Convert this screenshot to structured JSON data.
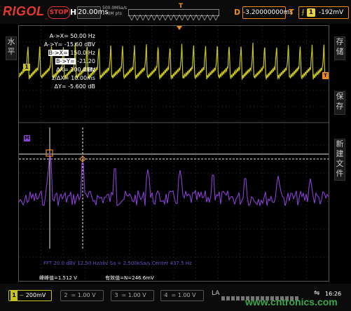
{
  "header": {
    "brand": "RIGOL",
    "run_state": "STOP",
    "timebase_label": "H",
    "timebase": "20.00ms",
    "sample_rate": "500.0MSa/s",
    "memory_depth": "140M pts",
    "delay_label": "D",
    "delay": "-3.20000000ms",
    "trigger_label": "T",
    "trigger_channel": "1",
    "trigger_level": "-192mV"
  },
  "left_menu": {
    "label": "水平"
  },
  "right_menu": {
    "items": [
      "存储",
      "保存",
      "新建文件"
    ]
  },
  "measurements": [
    {
      "label": "A->X=",
      "value": "50.00 Hz",
      "highlight": false
    },
    {
      "label": "A->Y=",
      "value": "-15.60 dBV",
      "highlight": false
    },
    {
      "label": "B->X=",
      "value": "150.0 Hz",
      "highlight": true
    },
    {
      "label": "B->Y=",
      "value": "-21.20 dBV",
      "highlight": true
    },
    {
      "label": "ΔX=",
      "value": "100.0 Hz",
      "highlight": false
    },
    {
      "label": "1/ΔX=",
      "value": "10.00ms",
      "highlight": false
    },
    {
      "label": "ΔY=",
      "value": "-5.600 dB",
      "highlight": false
    }
  ],
  "fft_info": "FFT  20.0 dBV   12.50 Hz/div   Sa = 2.500kSa/s   Center 437.5 Hz",
  "math_info": {
    "left": "峰峰值=1.512 V",
    "right": "有效值=N=246.6mV"
  },
  "channels": [
    {
      "num": "1",
      "value": "200mV",
      "active": true
    },
    {
      "num": "2",
      "value": "1.00 V",
      "active": false
    },
    {
      "num": "3",
      "value": "1.00 V",
      "active": false
    },
    {
      "num": "4",
      "value": "1.00 V",
      "active": false
    }
  ],
  "status": {
    "la_label": "LA",
    "time": "16:26"
  },
  "watermark": "www.cntronics.com",
  "colors": {
    "ch1": "#c8c31e",
    "math": "#8a3fd6",
    "trigger": "#f08a18",
    "brand": "#e23a2e"
  }
}
